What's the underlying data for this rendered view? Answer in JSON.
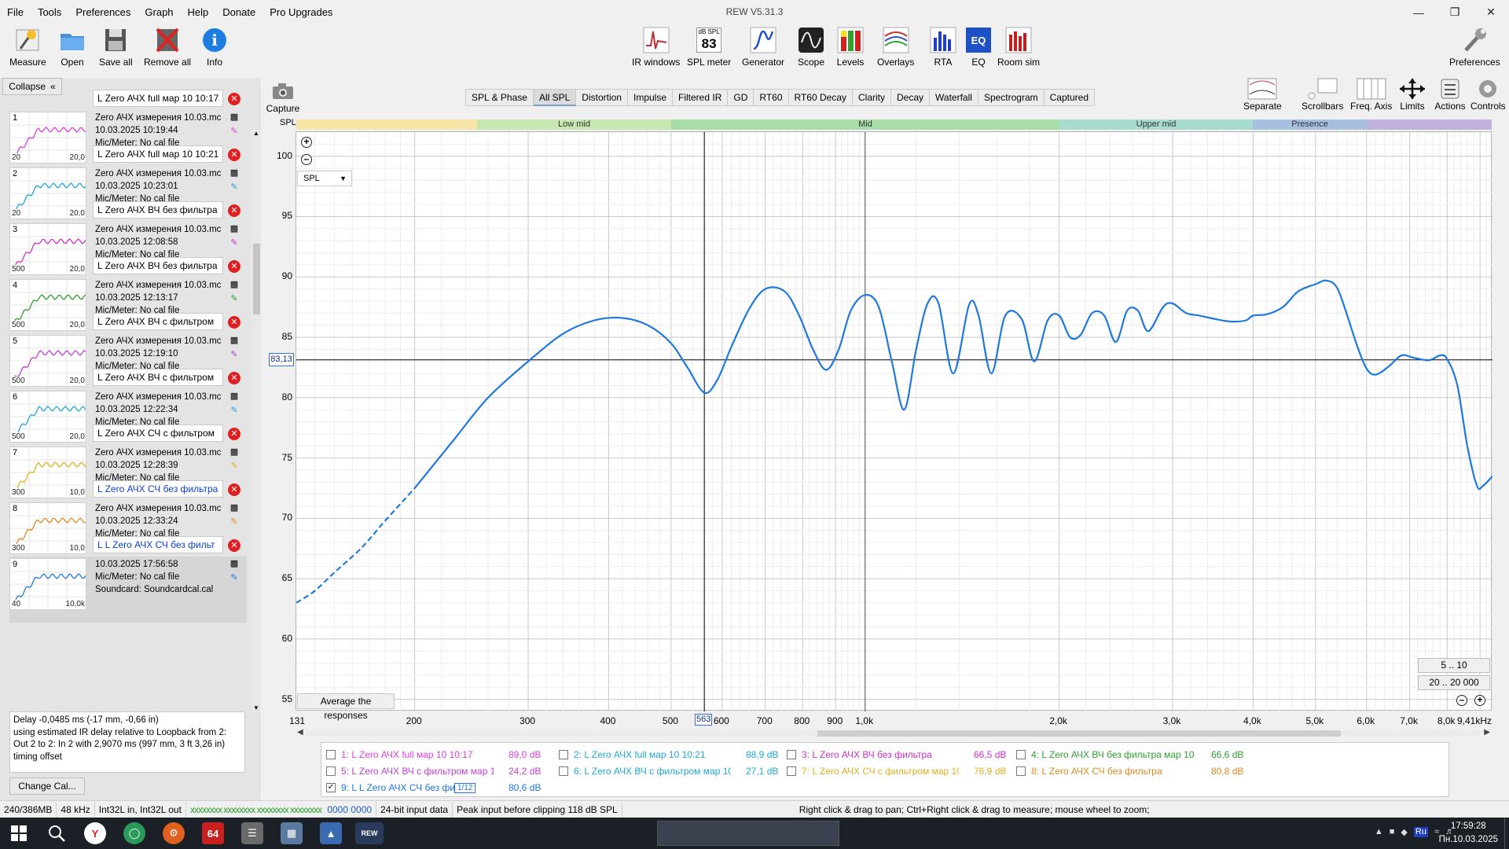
{
  "window": {
    "title": "REW V5.31.3"
  },
  "menu": [
    "File",
    "Tools",
    "Preferences",
    "Graph",
    "Help",
    "Donate",
    "Pro Upgrades"
  ],
  "toolbar_left": [
    {
      "label": "Measure",
      "icon": "microphone-icon"
    },
    {
      "label": "Open",
      "icon": "folder-icon"
    },
    {
      "label": "Save all",
      "icon": "save-icon"
    },
    {
      "label": "Remove all",
      "icon": "remove-icon"
    },
    {
      "label": "Info",
      "icon": "info-icon"
    }
  ],
  "toolbar_center": [
    {
      "label": "IR windows",
      "icon": "ir-windows-icon"
    },
    {
      "label": "SPL meter",
      "icon": "spl-meter-icon",
      "badge_top": "dB SPL",
      "badge_value": "83"
    },
    {
      "label": "Generator",
      "icon": "generator-icon"
    },
    {
      "label": "Scope",
      "icon": "scope-icon"
    },
    {
      "label": "Levels",
      "icon": "levels-icon"
    },
    {
      "label": "Overlays",
      "icon": "overlays-icon"
    },
    {
      "label": "RTA",
      "icon": "rta-icon"
    },
    {
      "label": "EQ",
      "icon": "eq-icon"
    },
    {
      "label": "Room sim",
      "icon": "room-sim-icon"
    }
  ],
  "toolbar_right": {
    "label": "Preferences",
    "icon": "wrench-icon"
  },
  "left_panel": {
    "collapse_label": "Collapse",
    "change_cal_label": "Change Cal...",
    "info_lines": [
      "Delay -0,0485 ms (-17 mm, -0,66 in)",
      "using estimated IR delay relative to Loopback from 2:",
      "Out 2 to 2: In 2 with 2,9070 ms (997 mm, 3 ft 3,26 in)",
      "timing offset"
    ],
    "measurements": [
      {
        "num": "1",
        "name": "L Zero АЧХ full мар 10 10:17",
        "desc": "Zero АЧХ измерения 10.03.mc",
        "date": "10.03.2025 10:19:44",
        "cal": "Mic/Meter: No cal file",
        "lo": "20",
        "hi": "20,0",
        "color": "#e040e0"
      },
      {
        "num": "2",
        "name": "L Zero АЧХ full мар 10 10:21",
        "desc": "Zero АЧХ измерения 10.03.mc",
        "date": "10.03.2025 10:23:01",
        "cal": "Mic/Meter: No cal file",
        "lo": "20",
        "hi": "20,0",
        "color": "#20a8d8"
      },
      {
        "num": "3",
        "name": "L Zero АЧХ ВЧ без фильтра",
        "desc": "Zero АЧХ измерения 10.03.mc",
        "date": "10.03.2025 12:08:58",
        "cal": "Mic/Meter: No cal file",
        "lo": "500",
        "hi": "20,0",
        "color": "#d030c8"
      },
      {
        "num": "4",
        "name": "L Zero АЧХ ВЧ без фильтра",
        "desc": "Zero АЧХ измерения 10.03.mc",
        "date": "10.03.2025 12:13:17",
        "cal": "Mic/Meter: No cal file",
        "lo": "500",
        "hi": "20,0",
        "color": "#30a030"
      },
      {
        "num": "5",
        "name": "L Zero АЧХ ВЧ с фильтром",
        "desc": "Zero АЧХ измерения 10.03.mc",
        "date": "10.03.2025 12:19:10",
        "cal": "Mic/Meter: No cal file",
        "lo": "500",
        "hi": "20,0",
        "color": "#c040d8"
      },
      {
        "num": "6",
        "name": "L Zero АЧХ ВЧ с фильтром",
        "desc": "Zero АЧХ измерения 10.03.mc",
        "date": "10.03.2025 12:22:34",
        "cal": "Mic/Meter: No cal file",
        "lo": "500",
        "hi": "20,0",
        "color": "#20a8d8"
      },
      {
        "num": "7",
        "name": "L Zero АЧХ СЧ с фильтром",
        "desc": "Zero АЧХ измерения 10.03.mc",
        "date": "10.03.2025 12:28:39",
        "cal": "Mic/Meter: No cal file",
        "lo": "300",
        "hi": "10,0",
        "color": "#e0b020"
      },
      {
        "num": "8",
        "name": "L Zero АЧХ СЧ без фильтра",
        "desc": "Zero АЧХ измерения 10.03.mc",
        "date": "10.03.2025 12:33:24",
        "cal": "Mic/Meter: No cal file",
        "lo": "300",
        "hi": "10,0",
        "color": "#e08a20",
        "blue_name": true
      },
      {
        "num": "9",
        "name": "L L Zero АЧХ СЧ без фильт",
        "desc": "10.03.2025 17:56:58",
        "date": "Mic/Meter: No cal file",
        "cal": "Soundcard: Soundcardcal.cal",
        "lo": "40",
        "hi": "10,0k",
        "color": "#1e78e0",
        "blue_name": true,
        "selected": true
      }
    ]
  },
  "graph": {
    "capture_label": "Capture",
    "tabs": [
      "SPL & Phase",
      "All SPL",
      "Distortion",
      "Impulse",
      "Filtered IR",
      "GD",
      "RT60",
      "RT60 Decay",
      "Clarity",
      "Decay",
      "Waterfall",
      "Spectrogram",
      "Captured"
    ],
    "active_tab": "All SPL",
    "right_tools": [
      {
        "label": "Separate",
        "icon": "separate-icon"
      },
      {
        "label": "Scrollbars",
        "icon": "scrollbars-icon"
      },
      {
        "label": "Freq. Axis",
        "icon": "freq-axis-icon"
      },
      {
        "label": "Limits",
        "icon": "limits-icon"
      },
      {
        "label": "Actions",
        "icon": "actions-icon"
      },
      {
        "label": "Controls",
        "icon": "controls-icon"
      }
    ],
    "y_axis_label": "SPL",
    "bands": [
      {
        "label": "",
        "color": "#f5e6a8"
      },
      {
        "label": "Low mid",
        "color": "#c6e8b0"
      },
      {
        "label": "Mid",
        "color": "#a8dca8"
      },
      {
        "label": "Upper mid",
        "color": "#a8dcd0"
      },
      {
        "label": "Presence",
        "color": "#a8c0e0"
      },
      {
        "label": "",
        "color": "#c0b0dc"
      }
    ],
    "spl_select": "SPL",
    "avg_button": "Average the responses",
    "cursor_y": "83,13",
    "cursor_x": "563",
    "range_buttons": [
      "5 .. 10",
      "20 .. 20 000"
    ],
    "y_ticks": [
      "100",
      "95",
      "90",
      "85",
      "80",
      "75",
      "70",
      "65",
      "60",
      "55"
    ],
    "x_ticks": [
      "131",
      "200",
      "300",
      "400",
      "500",
      "600",
      "700",
      "800",
      "900",
      "1,0k",
      "2,0k",
      "3,0k",
      "4,0k",
      "5,0k",
      "6,0k",
      "7,0k",
      "8,0k",
      "9,41kHz"
    ]
  },
  "chart_data": {
    "type": "line",
    "title": "",
    "xlabel": "",
    "ylabel": "SPL",
    "x_scale": "log",
    "xlim": [
      131,
      9410
    ],
    "ylim": [
      54,
      102
    ],
    "grid": true,
    "cursor": {
      "x": 563,
      "y": 83.13
    },
    "series": [
      {
        "name": "9: L L Zero АЧХ СЧ без фильтра",
        "color": "#1e78e0",
        "dashed_below_x": 200,
        "x": [
          131,
          140,
          150,
          165,
          180,
          200,
          230,
          260,
          300,
          340,
          380,
          420,
          460,
          500,
          530,
          563,
          590,
          620,
          660,
          700,
          750,
          790,
          830,
          870,
          910,
          950,
          1000,
          1050,
          1100,
          1150,
          1200,
          1250,
          1300,
          1370,
          1450,
          1500,
          1570,
          1650,
          1750,
          1830,
          1920,
          2000,
          2080,
          2160,
          2250,
          2350,
          2450,
          2550,
          2650,
          2750,
          2900,
          3000,
          3150,
          3300,
          3500,
          3700,
          3900,
          4000,
          4200,
          4450,
          4700,
          5000,
          5200,
          5400,
          5600,
          5800,
          6000,
          6200,
          6500,
          6800,
          7100,
          7500,
          7800,
          8000,
          8300,
          8600,
          8900,
          9100,
          9410
        ],
        "y": [
          63,
          64,
          65.5,
          67.5,
          69.8,
          72.5,
          76.5,
          80,
          83,
          85.3,
          86.4,
          86.6,
          86,
          84.5,
          82.5,
          80.4,
          81.5,
          84.2,
          87.3,
          89,
          88.8,
          86.8,
          84,
          82.3,
          84,
          87.2,
          88.5,
          87.5,
          83,
          79,
          84,
          87.8,
          87.8,
          82,
          87.7,
          86.8,
          82,
          86.8,
          86.5,
          83,
          86.4,
          86.8,
          85,
          85.2,
          87,
          86.8,
          84.6,
          87.2,
          87.2,
          85.5,
          87.5,
          87.8,
          87,
          86.8,
          86.5,
          86.3,
          86.4,
          86.8,
          86.9,
          87.5,
          88.8,
          89.4,
          89.7,
          89.1,
          86.8,
          84.3,
          82.4,
          81.9,
          82.6,
          83.5,
          83.3,
          83.1,
          83.5,
          83.2,
          81,
          76,
          72.7,
          72.7,
          73.5
        ]
      }
    ]
  },
  "legend": [
    {
      "label": "1: L Zero АЧХ full мар 10 10:17",
      "value": "89,0 dB",
      "color": "#e040e0",
      "checked": false
    },
    {
      "label": "2: L Zero АЧХ full мар 10 10:21",
      "value": "88,9 dB",
      "color": "#20a8d8",
      "checked": false
    },
    {
      "label": "3: L Zero АЧХ ВЧ без фильтра",
      "value": "66,5 dB",
      "color": "#d030c8",
      "checked": false
    },
    {
      "label": "4: L Zero АЧХ ВЧ без фильтра мар 10 ...",
      "value": "66,6 dB",
      "color": "#30a030",
      "checked": false
    },
    {
      "label": "5: L Zero АЧХ ВЧ с фильтром мар 10 1...",
      "value": "24,2 dB",
      "color": "#c040d8",
      "checked": false
    },
    {
      "label": "6: L Zero АЧХ ВЧ с фильтром мар 10 1...",
      "value": "27,1 dB",
      "color": "#20a8d8",
      "checked": false
    },
    {
      "label": "7: L Zero АЧХ СЧ с фильтром мар 10 1...",
      "value": "76,9 dB",
      "color": "#e0b020",
      "checked": false
    },
    {
      "label": "8: L Zero АЧХ СЧ без фильтра",
      "value": "80,8 dB",
      "color": "#e08a20",
      "checked": false
    },
    {
      "label": "9: L L Zero АЧХ СЧ без фильт",
      "value": "80,6 dB",
      "color": "#1e78e0",
      "checked": true,
      "smoothing": "1/12"
    }
  ],
  "status_bar": [
    "240/386MB",
    "48 kHz",
    "Int32L in, Int32L out",
    "0000 0000",
    "24-bit input data",
    "Peak input before clipping 118 dB SPL",
    "Right click & drag to pan; Ctrl+Right click & drag to measure; mouse wheel to zoom;"
  ],
  "taskbar": {
    "time": "17:59:28",
    "date": "Пн.10.03.2025",
    "lang": "Ru",
    "app_badge": "64",
    "active_app": "REW"
  }
}
